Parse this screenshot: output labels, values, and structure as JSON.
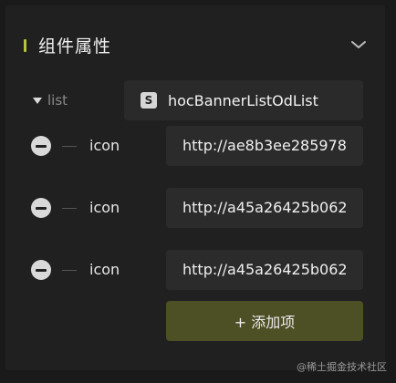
{
  "panel": {
    "title": "组件属性",
    "accent_color": "#b7c53a"
  },
  "list": {
    "label": "list",
    "component_icon": "S",
    "component_name": "hocBannerListOdList"
  },
  "items": [
    {
      "label": "icon",
      "value": "http://ae8b3ee285978"
    },
    {
      "label": "icon",
      "value": "http://a45a26425b062"
    },
    {
      "label": "icon",
      "value": "http://a45a26425b062"
    }
  ],
  "add_button": {
    "label": "+ 添加项",
    "color": "#4d4f25"
  },
  "watermark": "@稀土掘金技术社区"
}
